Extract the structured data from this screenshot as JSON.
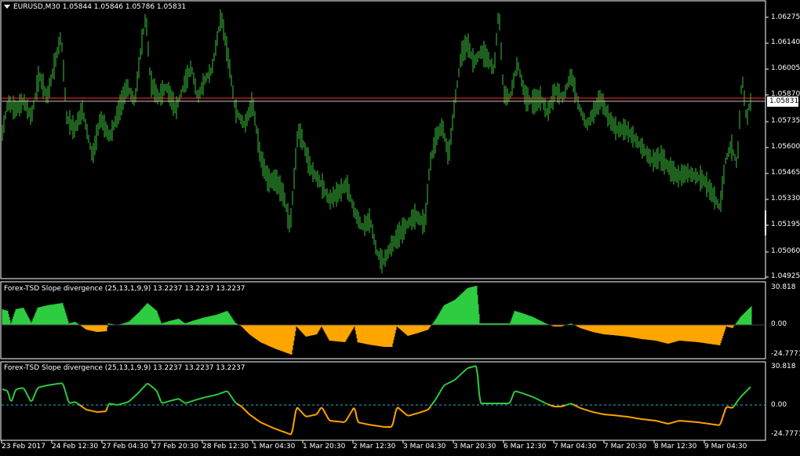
{
  "main": {
    "title": "EURUSD,M30  1.05844 1.05846 1.05786 1.05831",
    "price_labels": [
      "1.06275",
      "1.06140",
      "1.06005",
      "1.05870",
      "1.05735",
      "1.05600",
      "1.05465",
      "1.05330",
      "1.05195",
      "1.05060",
      "1.04925"
    ],
    "bid_label": "1.05831"
  },
  "ind1": {
    "title": "Forex-TSD Slope divergence (25,13,1,9,9) 13.2237 13.2237 13.2237",
    "scale": [
      "30.818",
      "0.00",
      "-24.7771"
    ]
  },
  "ind2": {
    "title": "Forex-TSD Slope divergence (25,13,1,9,9) 13.2237 13.2237 13.2237",
    "scale": [
      "30.818",
      "0.00",
      "-24.7771"
    ]
  },
  "time_labels": [
    "23 Feb 2017",
    "24 Feb 12:30",
    "27 Feb 04:30",
    "27 Feb 20:30",
    "28 Feb 12:30",
    "1 Mar 04:30",
    "1 Mar 20:30",
    "2 Mar 12:30",
    "3 Mar 04:30",
    "3 Mar 20:30",
    "6 Mar 12:30",
    "7 Mar 04:30",
    "7 Mar 20:30",
    "8 Mar 12:30",
    "9 Mar 04:30"
  ],
  "colors": {
    "bars": "#3cbf3c",
    "up": "#2ecc40",
    "down": "#ffa500",
    "grid": "#ffffff",
    "ask_line": "#ff3030",
    "bid_line": "#c0c0c0"
  }
}
